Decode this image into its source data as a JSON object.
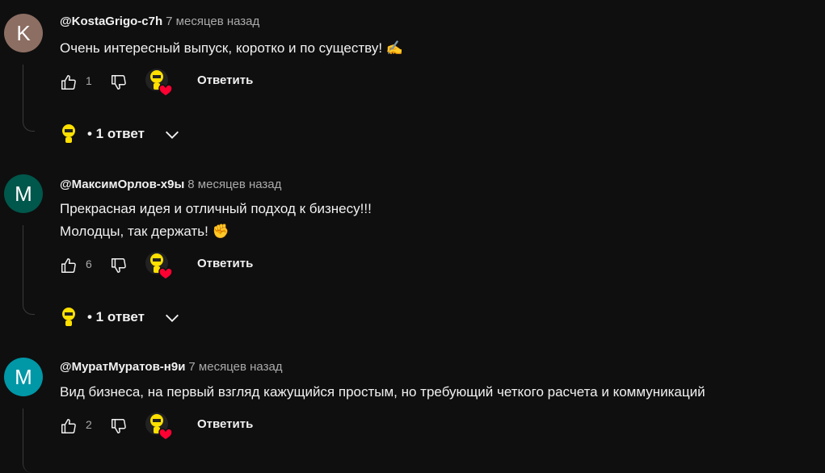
{
  "comments": [
    {
      "avatar_letter": "K",
      "avatar_color": "#8d6e63",
      "author": "@KostaGrigo-c7h",
      "time": "7 месяцев назад",
      "lines": [
        "Очень интересный выпуск, коротко и по существу! ✍️"
      ],
      "likes": "1",
      "reply_label": "Ответить",
      "replies_label": "• 1 ответ"
    },
    {
      "avatar_letter": "M",
      "avatar_color": "#00574b",
      "author": "@МаксимОрлов-х9ы",
      "time": "8 месяцев назад",
      "lines": [
        "Прекрасная идея и отличный подход к бизнесу!!!",
        "Молодцы, так держать! ✊"
      ],
      "likes": "6",
      "reply_label": "Ответить",
      "replies_label": "• 1 ответ"
    },
    {
      "avatar_letter": "M",
      "avatar_color": "#0097a7",
      "author": "@МуратМуратов-н9и",
      "time": "7 месяцев назад",
      "lines": [
        "Вид бизнеса, на первый взгляд кажущийся простым, но требующий четкого расчета и коммуникаций"
      ],
      "likes": "2",
      "reply_label": "Ответить"
    }
  ],
  "colors": {
    "background": "#0f0f0f",
    "creator_badge": "#ffe000",
    "heart": "#ff0033"
  },
  "icons": [
    "like-icon",
    "dislike-icon",
    "creator-heart-icon",
    "creator-avatar-icon",
    "chevron-down-icon"
  ]
}
